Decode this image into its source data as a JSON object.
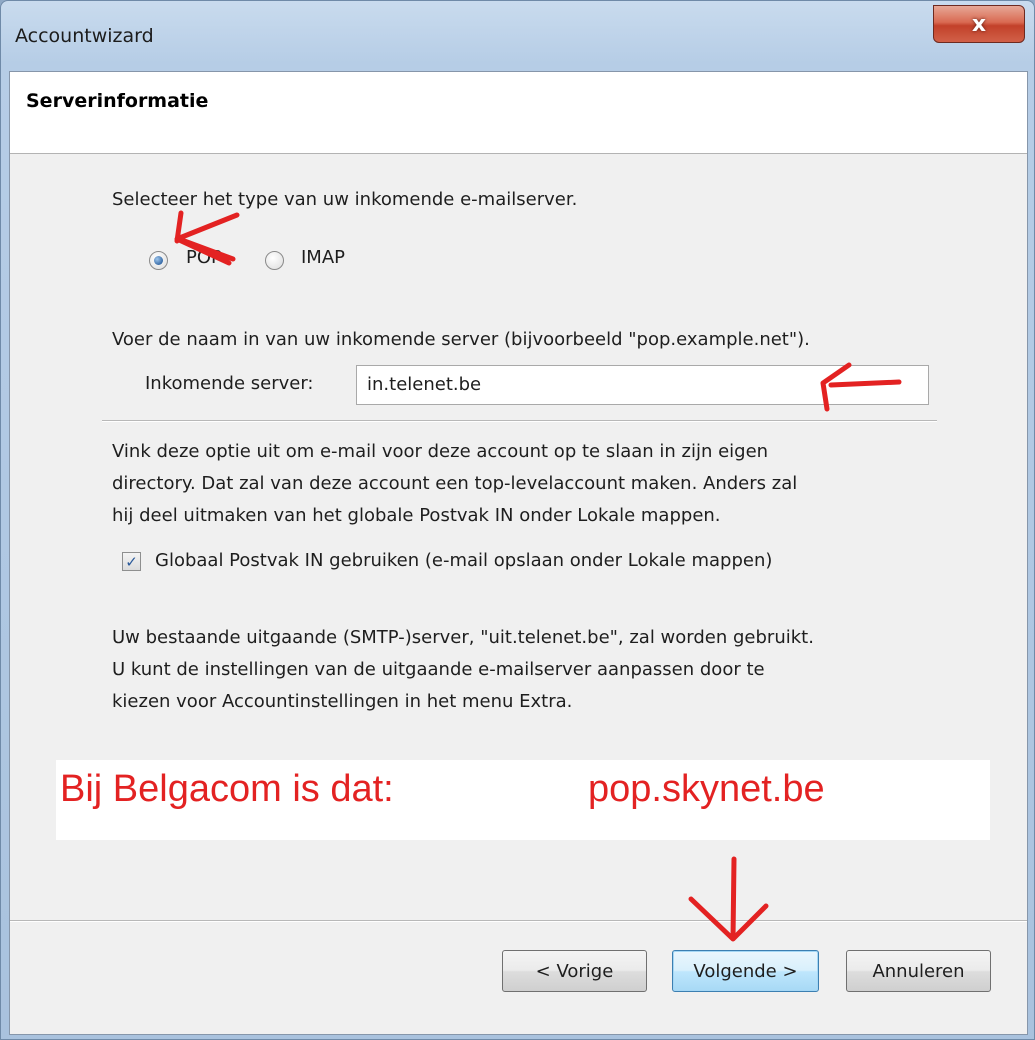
{
  "window": {
    "title": "Accountwizard",
    "close_glyph": "x"
  },
  "header": {
    "title": "Serverinformatie"
  },
  "server_type": {
    "prompt": "Selecteer het type van uw inkomende e-mailserver.",
    "options": [
      {
        "label": "POP",
        "selected": true
      },
      {
        "label": "IMAP",
        "selected": false
      }
    ]
  },
  "incoming": {
    "prompt": "Voer de naam in van uw inkomende server (bijvoorbeeld \"pop.example.net\").",
    "field_label": "Inkomende server:",
    "field_value": "in.telenet.be"
  },
  "global_inbox": {
    "description_lines": [
      "Vink deze optie uit om e-mail voor deze account op te slaan in zijn eigen",
      "directory. Dat zal van deze account een top-levelaccount maken. Anders zal",
      "hij deel uitmaken van het globale Postvak IN onder Lokale mappen."
    ],
    "checkbox_label": "Globaal Postvak IN gebruiken (e-mail opslaan onder Lokale mappen)",
    "checked": true
  },
  "smtp_info": {
    "lines": [
      "Uw bestaande uitgaande (SMTP-)server, \"uit.telenet.be\", zal worden gebruikt.",
      "U kunt de instellingen van de uitgaande e-mailserver aanpassen door te",
      "kiezen voor Accountinstellingen in het menu Extra."
    ]
  },
  "annotation": {
    "left_text": "Bij Belgacom is dat:",
    "right_text": "pop.skynet.be",
    "color": "#e32222"
  },
  "buttons": {
    "back": "< Vorige",
    "next": "Volgende >",
    "cancel": "Annuleren"
  },
  "colors": {
    "accent": "#2a5f9e",
    "annotation_red": "#e32222"
  }
}
